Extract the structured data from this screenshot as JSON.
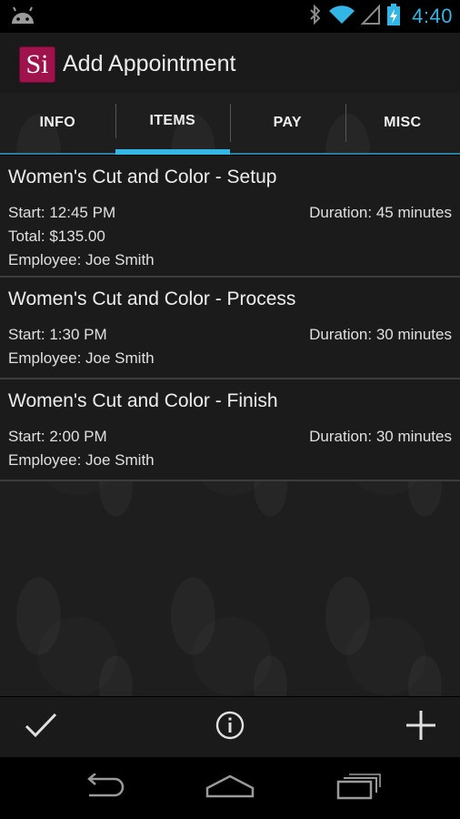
{
  "status_bar": {
    "time": "4:40"
  },
  "action_bar": {
    "logo_text": "Si",
    "title": "Add Appointment"
  },
  "tabs": [
    {
      "label": "INFO",
      "active": false
    },
    {
      "label": "ITEMS",
      "active": true
    },
    {
      "label": "PAY",
      "active": false
    },
    {
      "label": "MISC",
      "active": false
    }
  ],
  "items": [
    {
      "title": "Women's Cut and Color - Setup",
      "start": "Start:  12:45 PM",
      "duration": "Duration: 45 minutes",
      "total": "Total:  $135.00",
      "employee": "Employee: Joe Smith"
    },
    {
      "title": "Women's Cut and Color - Process",
      "start": "Start:  1:30 PM",
      "duration": "Duration: 30 minutes",
      "employee": "Employee: Joe Smith"
    },
    {
      "title": "Women's Cut and Color - Finish",
      "start": "Start:  2:00 PM",
      "duration": "Duration: 30 minutes",
      "employee": "Employee: Joe Smith"
    }
  ],
  "colors": {
    "accent": "#33b5e5",
    "logo": "#a0124c"
  }
}
